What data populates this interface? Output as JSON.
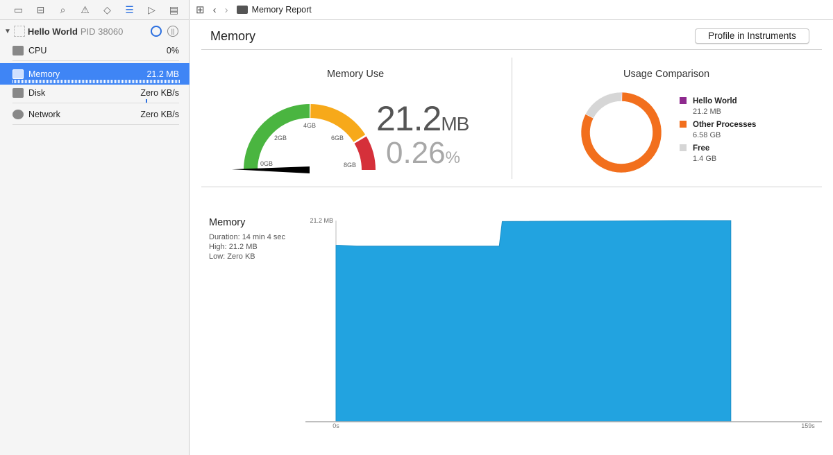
{
  "navigator": {
    "icons": [
      "folder-icon",
      "hierarchy-icon",
      "search-icon",
      "warning-icon",
      "test-diamond-icon",
      "debug-gauges-icon",
      "breakpoint-icon",
      "report-icon"
    ]
  },
  "process": {
    "name": "Hello World",
    "pid": "PID 38060"
  },
  "gauges": [
    {
      "label": "CPU",
      "value": "0%"
    },
    {
      "label": "Memory",
      "value": "21.2 MB"
    },
    {
      "label": "Disk",
      "value": "Zero KB/s"
    },
    {
      "label": "Network",
      "value": "Zero KB/s"
    }
  ],
  "jumpbar": {
    "title": "Memory Report"
  },
  "main": {
    "title": "Memory",
    "profile_button": "Profile in Instruments"
  },
  "memory_use": {
    "title": "Memory Use",
    "value": "21.2",
    "unit": "MB",
    "percent": "0.26",
    "percent_unit": "%",
    "ticks": [
      "0GB",
      "2GB",
      "4GB",
      "6GB",
      "8GB"
    ],
    "needle_fraction": 0.0026
  },
  "usage": {
    "title": "Usage Comparison",
    "items": [
      {
        "name": "Hello World",
        "value": "21.2 MB",
        "color": "#8e2a8e",
        "gb": 0.0212
      },
      {
        "name": "Other Processes",
        "value": "6.58 GB",
        "color": "#f26f1d",
        "gb": 6.58
      },
      {
        "name": "Free",
        "value": "1.4 GB",
        "color": "#d6d6d6",
        "gb": 1.4
      }
    ]
  },
  "history": {
    "title": "Memory",
    "duration": "Duration: 14 min 4 sec",
    "high": "High: 21.2 MB",
    "low": "Low: Zero KB"
  },
  "chart_data": {
    "type": "area",
    "ylabel_max": "21.2 MB",
    "ylim": [
      0,
      21.2
    ],
    "xlim": [
      0,
      159
    ],
    "xtick_labels": [
      "0s",
      "159s"
    ],
    "x": [
      0,
      1,
      7,
      55,
      56,
      115,
      133
    ],
    "y": [
      18.6,
      18.6,
      18.5,
      18.5,
      21.1,
      21.2,
      21.2
    ],
    "color": "#22a3e0"
  }
}
